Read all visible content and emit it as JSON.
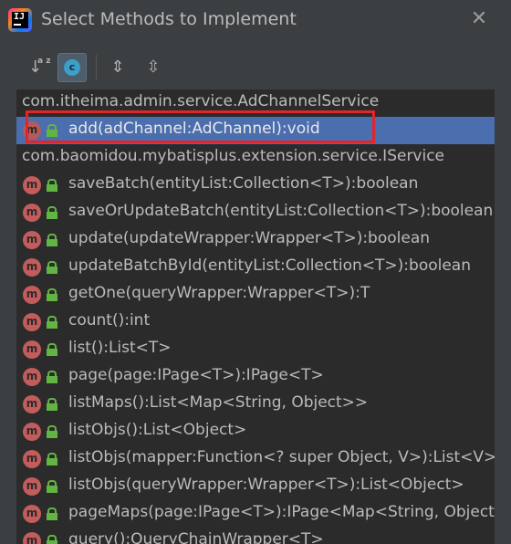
{
  "dialog": {
    "title": "Select Methods to Implement",
    "close_glyph": "✕",
    "logo_text": "IJ"
  },
  "toolbar": {
    "sort_alpha_glyph": "↓",
    "sort_alpha_letters": "a z",
    "show_classes_glyph": "c",
    "expand_all_glyph": "⇕",
    "collapse_all_glyph": "⇳"
  },
  "tree": {
    "groups": [
      {
        "label": "com.itheima.admin.service.AdChannelService",
        "methods": [
          {
            "label": "add(adChannel:AdChannel):void",
            "selected": true
          }
        ]
      },
      {
        "label": "com.baomidou.mybatisplus.extension.service.IService",
        "methods": [
          {
            "label": "saveBatch(entityList:Collection<T>):boolean"
          },
          {
            "label": "saveOrUpdateBatch(entityList:Collection<T>):boolean"
          },
          {
            "label": "update(updateWrapper:Wrapper<T>):boolean"
          },
          {
            "label": "updateBatchById(entityList:Collection<T>):boolean"
          },
          {
            "label": "getOne(queryWrapper:Wrapper<T>):T"
          },
          {
            "label": "count():int"
          },
          {
            "label": "list():List<T>"
          },
          {
            "label": "page(page:IPage<T>):IPage<T>"
          },
          {
            "label": "listMaps():List<Map<String, Object>>"
          },
          {
            "label": "listObjs():List<Object>"
          },
          {
            "label": "listObjs(mapper:Function<? super Object, V>):List<V>"
          },
          {
            "label": "listObjs(queryWrapper:Wrapper<T>):List<Object>"
          },
          {
            "label": "pageMaps(page:IPage<T>):IPage<Map<String, Object>>"
          },
          {
            "label": "query():QueryChainWrapper<T>"
          }
        ]
      }
    ],
    "method_icon_letter": "m",
    "method_icon": "method-icon",
    "visibility_icon": "public-lock-icon"
  },
  "colors": {
    "selection": "#4b6eaf",
    "annotation_box": "#e0262c",
    "method_icon": "#c45c5c",
    "lock_icon": "#62b543"
  }
}
